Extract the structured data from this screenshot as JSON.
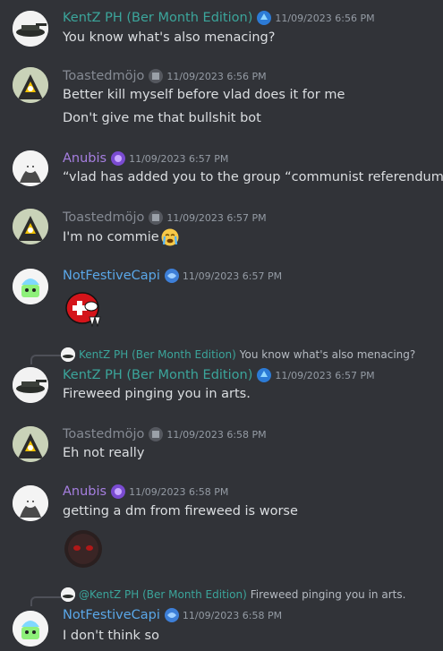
{
  "messages": [
    {
      "user": "KentZ PH (Ber Month Edition)",
      "color": "#3ba59b",
      "time": "11/09/2023 6:56 PM",
      "lines": [
        "You know what's also menacing?"
      ]
    },
    {
      "user": "Toastedmöjo",
      "color": "#858a93",
      "time": "11/09/2023 6:56 PM",
      "lines": [
        "Better kill myself before vlad does it for me",
        "Don't give me that bullshit bot"
      ]
    },
    {
      "user": "Anubis",
      "color": "#a67fe0",
      "time": "11/09/2023 6:57 PM",
      "lines": [
        "“vlad has added you to the group “communist referendum”!”"
      ]
    },
    {
      "user": "Toastedmöjo",
      "color": "#858a93",
      "time": "11/09/2023 6:57 PM",
      "lines": [
        "I'm no commie"
      ]
    },
    {
      "user": "NotFestiveCapi",
      "color": "#5aa7e8",
      "time": "11/09/2023 6:57 PM",
      "lines": []
    },
    {
      "user": "KentZ PH (Ber Month Edition)",
      "color": "#3ba59b",
      "time": "11/09/2023 6:57 PM",
      "lines": [
        "Fireweed pinging you in arts."
      ],
      "reply": {
        "name": "KentZ PH (Ber Month Edition)",
        "text": "You know what's also menacing?"
      }
    },
    {
      "user": "Toastedmöjo",
      "color": "#858a93",
      "time": "11/09/2023 6:58 PM",
      "lines": [
        "Eh not really"
      ]
    },
    {
      "user": "Anubis",
      "color": "#a67fe0",
      "time": "11/09/2023 6:58 PM",
      "lines": [
        "getting a dm from fireweed is worse"
      ]
    },
    {
      "user": "NotFestiveCapi",
      "color": "#5aa7e8",
      "time": "11/09/2023 6:58 PM",
      "lines": [
        "I don't think so"
      ],
      "reply": {
        "name": "@KentZ PH (Ber Month Edition)",
        "text": "Fireweed pinging you in arts."
      }
    }
  ]
}
